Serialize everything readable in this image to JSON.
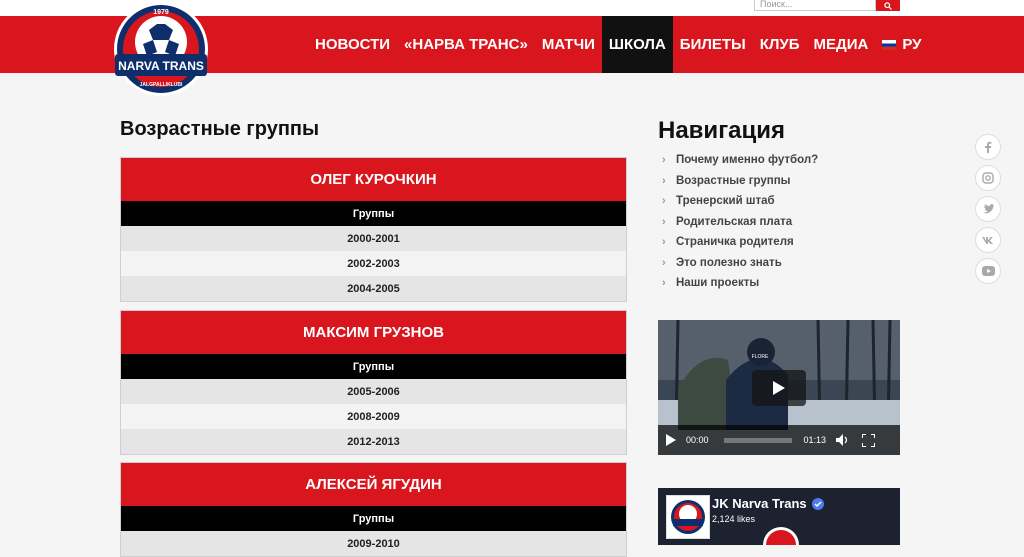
{
  "search": {
    "placeholder": "Поиск..."
  },
  "logo": {
    "year": "1979",
    "name": "NARVA TRANS",
    "sub": "JALGPALLIKLUBI"
  },
  "menu": {
    "items": [
      {
        "label": "НОВОСТИ",
        "active": false
      },
      {
        "label": "«НАРВА ТРАНС»",
        "active": false
      },
      {
        "label": "МАТЧИ",
        "active": false
      },
      {
        "label": "ШКОЛА",
        "active": true
      },
      {
        "label": "БИЛЕТЫ",
        "active": false
      },
      {
        "label": "КЛУБ",
        "active": false
      },
      {
        "label": "МЕДИА",
        "active": false
      }
    ],
    "language": "РУ"
  },
  "main": {
    "title": "Возрастные группы",
    "groups": [
      {
        "coach": "ОЛЕГ КУРОЧКИН",
        "header": "Группы",
        "years": [
          "2000-2001",
          "2002-2003",
          "2004-2005"
        ]
      },
      {
        "coach": "МАКСИМ ГРУЗНОВ",
        "header": "Группы",
        "years": [
          "2005-2006",
          "2008-2009",
          "2012-2013"
        ]
      },
      {
        "coach": "АЛЕКСЕЙ ЯГУДИН",
        "header": "Группы",
        "years": [
          "2009-2010"
        ]
      }
    ]
  },
  "sidebar": {
    "title": "Навигация",
    "links": [
      "Почему именно футбол?",
      "Возрастные группы",
      "Тренерский штаб",
      "Родительская плата",
      "Страничка родителя",
      "Это полезно знать",
      "Наши проекты"
    ],
    "video": {
      "current_time": "00:00",
      "duration": "01:13",
      "overlay_text": "FLORE"
    },
    "facebook": {
      "name": "JK Narva Trans",
      "likes": "2,124 likes"
    }
  },
  "social": [
    "facebook-icon",
    "instagram-icon",
    "twitter-icon",
    "vk-icon",
    "youtube-icon"
  ],
  "colors": {
    "brand_red": "#d9161e",
    "active_black": "#111111",
    "row_dark": "#e5e5e5",
    "row_light": "#f3f3f3"
  }
}
